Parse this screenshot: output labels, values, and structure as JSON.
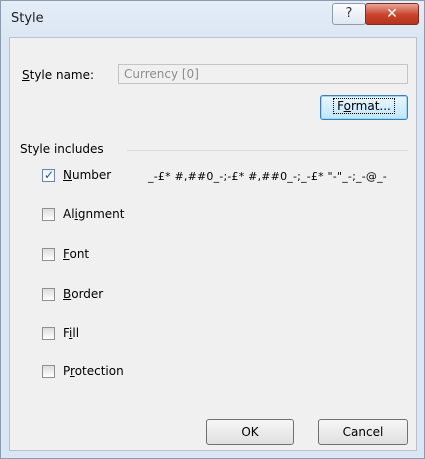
{
  "window": {
    "title": "Style",
    "help_label": "?",
    "close_label": "✕"
  },
  "style_name": {
    "label_underlined": "S",
    "label_rest": "tyle name:",
    "value": "Currency [0]"
  },
  "buttons": {
    "format_before": "F",
    "format_underlined": "o",
    "format_after": "rmat...",
    "ok": "OK",
    "cancel": "Cancel"
  },
  "style_includes": {
    "title": "Style includes",
    "number_format": "_-£* #,##0_-;-£* #,##0_-;_-£* \"-\"_-;_-@_-",
    "items": [
      {
        "before": "",
        "underlined": "N",
        "after": "umber",
        "checked": true
      },
      {
        "before": "Al",
        "underlined": "i",
        "after": "gnment",
        "checked": false
      },
      {
        "before": "",
        "underlined": "F",
        "after": "ont",
        "checked": false
      },
      {
        "before": "",
        "underlined": "B",
        "after": "order",
        "checked": false
      },
      {
        "before": "F",
        "underlined": "i",
        "after": "ll",
        "checked": false
      },
      {
        "before": "P",
        "underlined": "r",
        "after": "otection",
        "checked": false
      }
    ]
  }
}
